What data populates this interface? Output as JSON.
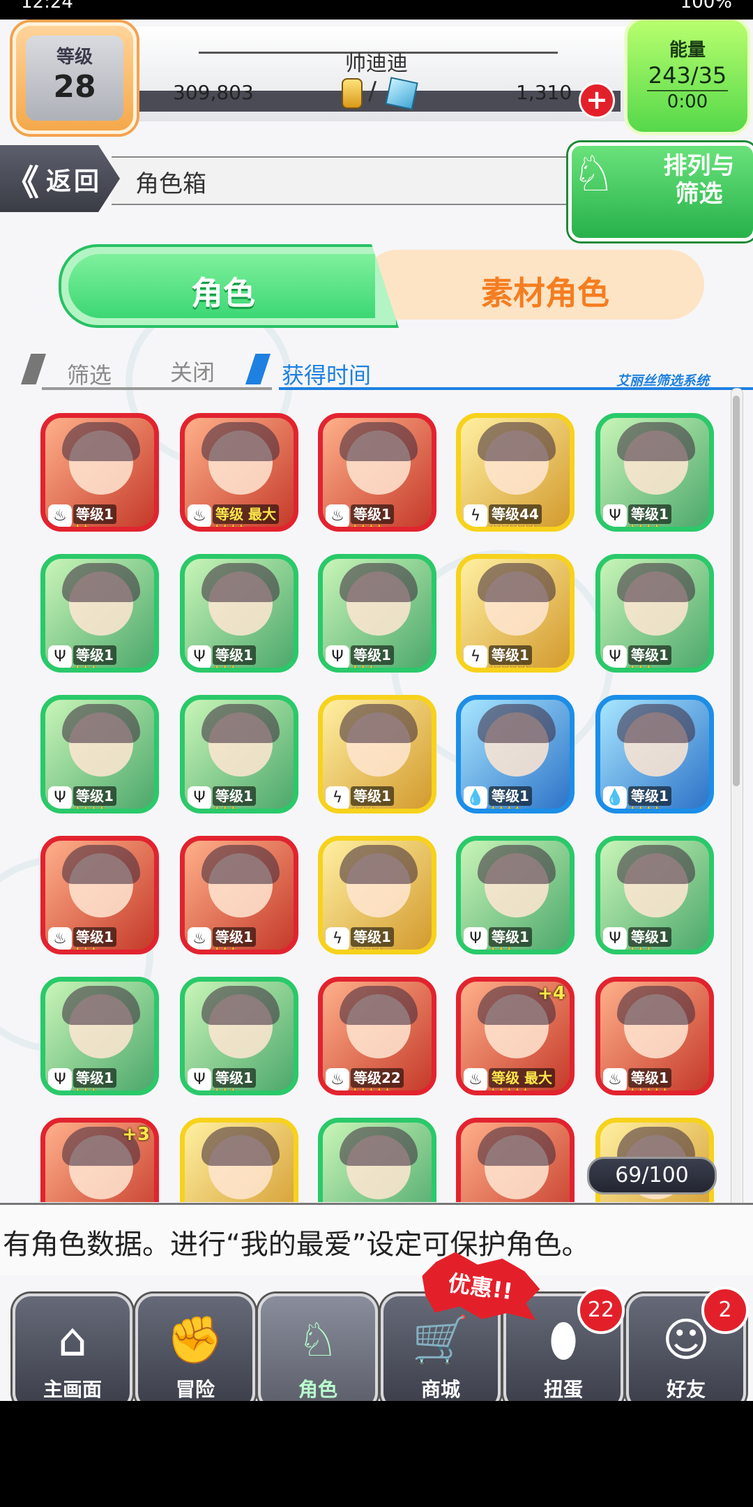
{
  "status_bar": {
    "time": "12:24",
    "battery": "100%"
  },
  "header": {
    "level_label": "等级",
    "level_value": "28",
    "user_name": "帅迪迪",
    "coins": "309,803",
    "separator": "/",
    "stones": "1,310",
    "plus_label": "+",
    "energy_label": "能量",
    "energy_value": "243/35",
    "energy_timer": "0:00"
  },
  "nav": {
    "back_label": "返回",
    "back_chevron": "《",
    "title": "角色箱",
    "sort_filter_label": "排列与筛选"
  },
  "tabs": {
    "characters": "角色",
    "materials": "素材角色"
  },
  "filter": {
    "filter_label": "筛选",
    "off_label": "关闭",
    "sort_key": "获得时间",
    "system_label": "艾丽丝筛选系统"
  },
  "elements": {
    "fire": "♨",
    "wood": "Ψ",
    "light": "ϟ",
    "water": "💧"
  },
  "cards": [
    {
      "element": "fire",
      "level": "等级1",
      "stars": "★★"
    },
    {
      "element": "fire",
      "level": "等级 最大",
      "stars": "★★★★",
      "max": true
    },
    {
      "element": "fire",
      "level": "等级1",
      "stars": "★★★★"
    },
    {
      "element": "light",
      "level": "等级44",
      "stars": "★★★★★★"
    },
    {
      "element": "wood",
      "level": "等级1",
      "stars": "★★★★"
    },
    {
      "element": "wood",
      "level": "等级1",
      "stars": "★★★"
    },
    {
      "element": "wood",
      "level": "等级1",
      "stars": "★★★"
    },
    {
      "element": "wood",
      "level": "等级1",
      "stars": "★★★"
    },
    {
      "element": "light",
      "level": "等级1",
      "stars": "★★★★★"
    },
    {
      "element": "wood",
      "level": "等级1",
      "stars": "★★★"
    },
    {
      "element": "wood",
      "level": "等级1",
      "stars": "★★★★"
    },
    {
      "element": "wood",
      "level": "等级1",
      "stars": "★★★"
    },
    {
      "element": "light",
      "level": "等级1",
      "stars": "★★★"
    },
    {
      "element": "water",
      "level": "等级1",
      "stars": "★★★★"
    },
    {
      "element": "water",
      "level": "等级1",
      "stars": "★★★★"
    },
    {
      "element": "fire",
      "level": "等级1",
      "stars": "★★★"
    },
    {
      "element": "fire",
      "level": "等级1",
      "stars": "★★★"
    },
    {
      "element": "light",
      "level": "等级1",
      "stars": "★★★★"
    },
    {
      "element": "wood",
      "level": "等级1",
      "stars": "★★★"
    },
    {
      "element": "wood",
      "level": "等级1",
      "stars": "★★★"
    },
    {
      "element": "wood",
      "level": "等级1",
      "stars": "★★★"
    },
    {
      "element": "wood",
      "level": "等级1",
      "stars": "★★★"
    },
    {
      "element": "fire",
      "level": "等级22",
      "stars": "★★★★★"
    },
    {
      "element": "fire",
      "level": "等级 最大",
      "stars": "★★★★★",
      "max": true,
      "plus": "+4"
    },
    {
      "element": "fire",
      "level": "等级1",
      "stars": "★★★★★"
    },
    {
      "element": "fire",
      "level": "",
      "stars": "",
      "plus": "+3"
    },
    {
      "element": "light",
      "level": "",
      "stars": ""
    },
    {
      "element": "wood",
      "level": "",
      "stars": ""
    },
    {
      "element": "fire",
      "level": "",
      "stars": ""
    },
    {
      "element": "light",
      "level": "",
      "stars": ""
    }
  ],
  "counter": "69/100",
  "ticker": "有角色数据。进行“我的最爱”设定可保护角色。",
  "bottom_nav": {
    "home": "主画面",
    "adventure": "冒险",
    "characters": "角色",
    "shop": "商城",
    "gacha": "扭蛋",
    "friends": "好友",
    "promo": "优惠!!",
    "gacha_badge": "22",
    "friends_badge": "2"
  }
}
